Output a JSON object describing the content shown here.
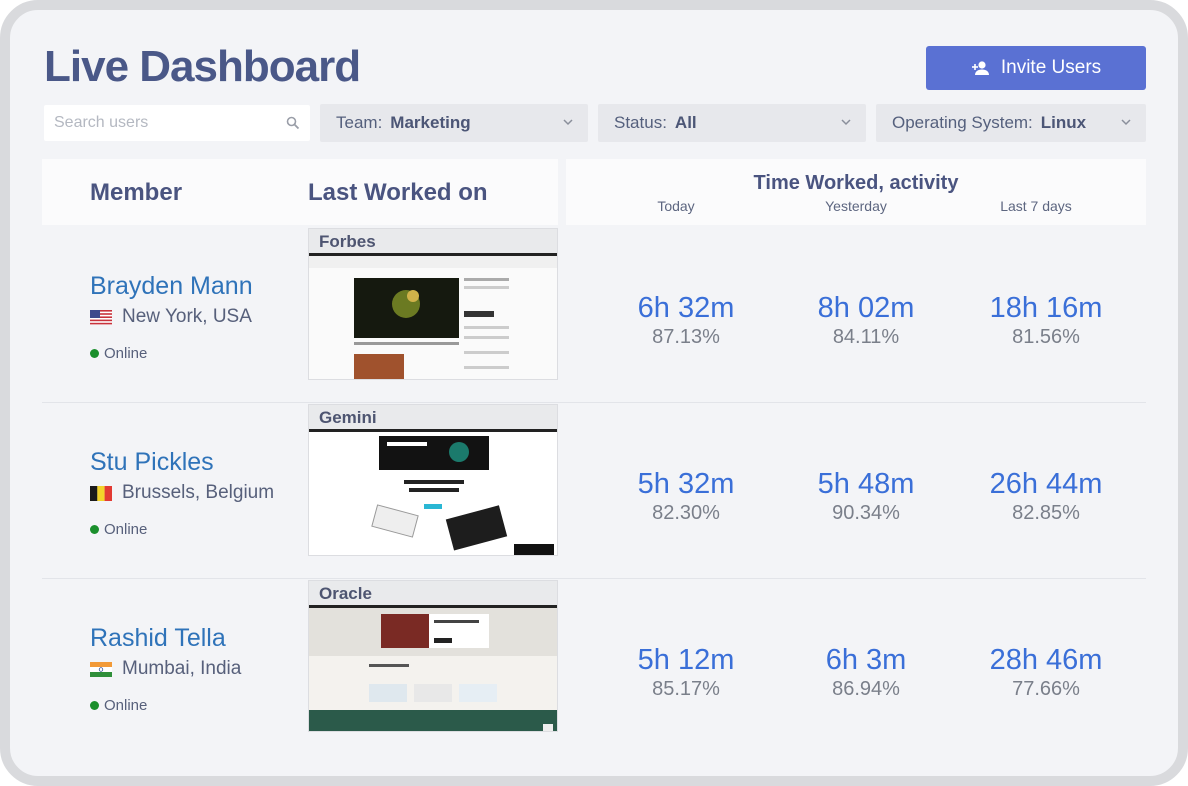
{
  "header": {
    "title": "Live Dashboard",
    "invite_label": "Invite Users"
  },
  "filters": {
    "search_placeholder": "Search users",
    "team": {
      "label": "Team:",
      "value": "Marketing"
    },
    "status": {
      "label": "Status:",
      "value": "All"
    },
    "os": {
      "label": "Operating System:",
      "value": "Linux"
    }
  },
  "table": {
    "col_member": "Member",
    "col_last_worked": "Last Worked on",
    "col_time": "Time Worked, activity",
    "sub_today": "Today",
    "sub_yesterday": "Yesterday",
    "sub_week": "Last 7 days"
  },
  "rows": [
    {
      "name": "Brayden Mann",
      "location": "New York, USA",
      "flag": "us-flag-icon",
      "status": "Online",
      "site": "Forbes",
      "today": {
        "time": "6h 32m",
        "pct": "87.13%"
      },
      "yesterday": {
        "time": "8h 02m",
        "pct": "84.11%"
      },
      "week": {
        "time": "18h 16m",
        "pct": "81.56%"
      }
    },
    {
      "name": "Stu Pickles",
      "location": "Brussels, Belgium",
      "flag": "belgium-flag-icon",
      "status": "Online",
      "site": "Gemini",
      "today": {
        "time": "5h 32m",
        "pct": "82.30%"
      },
      "yesterday": {
        "time": "5h 48m",
        "pct": "90.34%"
      },
      "week": {
        "time": "26h 44m",
        "pct": "82.85%"
      }
    },
    {
      "name": "Rashid Tella",
      "location": "Mumbai, India",
      "flag": "india-flag-icon",
      "status": "Online",
      "site": "Oracle",
      "today": {
        "time": "5h 12m",
        "pct": "85.17%"
      },
      "yesterday": {
        "time": "6h 3m",
        "pct": "86.94%"
      },
      "week": {
        "time": "28h 46m",
        "pct": "77.66%"
      }
    }
  ],
  "colors": {
    "accent": "#5a71d3",
    "name_link": "#2f73b9",
    "metric_time": "#3a6fd8",
    "online": "#1a8f2c"
  }
}
